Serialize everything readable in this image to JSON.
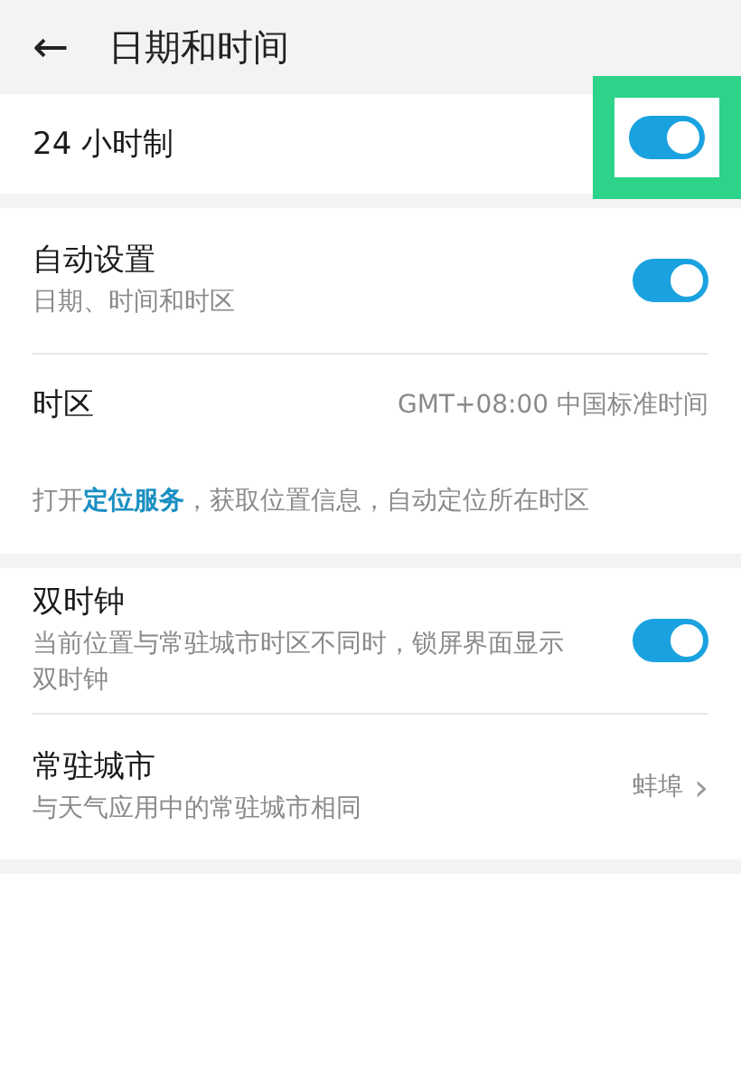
{
  "header": {
    "back_icon": "←",
    "title": "日期和时间"
  },
  "sections": [
    {
      "items": [
        {
          "kind": "switch",
          "title": "24 小时制",
          "on": true,
          "highlighted": true
        }
      ]
    },
    {
      "items": [
        {
          "kind": "switch",
          "title": "自动设置",
          "subtitle": "日期、时间和时区",
          "on": true,
          "highlighted": false
        },
        {
          "kind": "value",
          "title": "时区",
          "value": "GMT+08:00 中国标准时间"
        },
        {
          "kind": "note",
          "before": "打开",
          "link": "定位服务",
          "after": "，获取位置信息，自动定位所在时区"
        }
      ]
    },
    {
      "items": [
        {
          "kind": "switch",
          "title": "双时钟",
          "subtitle": "当前位置与常驻城市时区不同时，锁屏界面显示双时钟",
          "on": true,
          "highlighted": false
        },
        {
          "kind": "value",
          "title": "常驻城市",
          "subtitle": "与天气应用中的常驻城市相同",
          "value": "蚌埠",
          "chevron": "›"
        }
      ]
    }
  ]
}
